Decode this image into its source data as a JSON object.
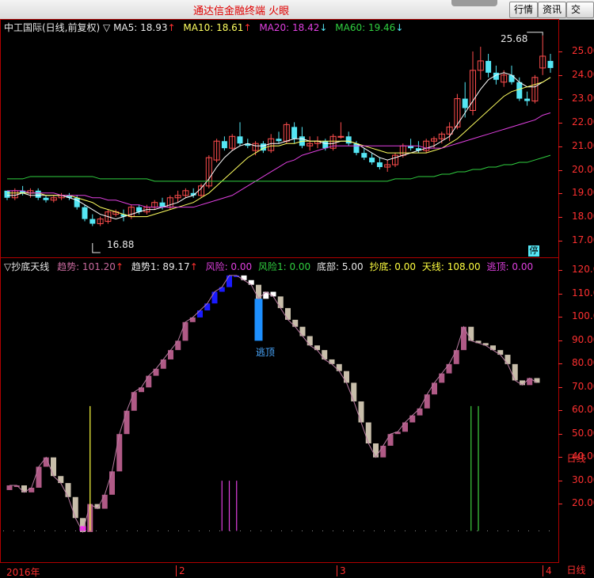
{
  "app": {
    "title": "通达信金融终端  火眼"
  },
  "toolbar": {
    "btn_hangqing": "行情",
    "btn_zixun": "资讯",
    "btn_jiaoyi": "交易"
  },
  "main_chart": {
    "stock_label": "中工国际(日线,前复权)",
    "ma5": "MA5: 18.93",
    "ma10": "MA10: 18.61",
    "ma20": "MA20: 18.42",
    "ma60": "MA60: 19.46",
    "high_label": "25.68",
    "low_label": "16.88",
    "halt_badge": "停",
    "price_ticks": [
      "25.00",
      "24.00",
      "23.00",
      "22.00",
      "21.00",
      "20.00",
      "19.00",
      "18.00",
      "17.00"
    ],
    "colors": {
      "up": "#ff4d4d",
      "down": "#55e6f4",
      "ma5": "#ffffff",
      "ma10": "#ffff60",
      "ma20": "#e040e0",
      "ma60": "#30d040"
    }
  },
  "indicator": {
    "name": "抄底天线",
    "qushi": "趋势: 101.20",
    "qushi1": "趋势1: 89.17",
    "fengxian": "风险: 0.00",
    "fengxian1": "风险1: 0.00",
    "dibu": "底部: 5.00",
    "chaodi": "抄底: 0.00",
    "tianxian": "天线: 108.00",
    "taoding": "逃顶: 0.00",
    "escape_label": "逃顶",
    "ticks": [
      "120.00",
      "110.00",
      "100.00",
      "90.00",
      "80.00",
      "70.00",
      "60.00",
      "50.00",
      "40.00",
      "30.00",
      "20.00"
    ],
    "colors": {
      "up": "#b05a86",
      "down": "#c8beaa",
      "risk": "#1a1aff",
      "escape": "#1e90ff"
    }
  },
  "dates": {
    "year": "2016年",
    "m2": "2",
    "m3": "3",
    "m4": "4"
  },
  "side": {
    "rixian1": "日线",
    "rixian2": "日线"
  },
  "chart_data": [
    {
      "type": "candlestick",
      "title": "中工国际(日线,前复权)",
      "ylim": [
        16.5,
        25.8
      ],
      "annotations": {
        "high": 25.68,
        "low": 16.88
      },
      "series": [
        {
          "name": "K",
          "ohlc": [
            [
              19.1,
              19.0,
              18.7,
              18.8
            ],
            [
              18.8,
              19.2,
              18.7,
              19.1
            ],
            [
              19.1,
              19.3,
              18.9,
              19.0
            ],
            [
              19.0,
              19.2,
              18.8,
              19.1
            ],
            [
              19.1,
              19.2,
              18.7,
              18.8
            ],
            [
              18.8,
              18.9,
              18.6,
              18.7
            ],
            [
              18.7,
              18.9,
              18.6,
              18.8
            ],
            [
              18.8,
              19.0,
              18.7,
              18.9
            ],
            [
              18.9,
              19.0,
              18.7,
              18.8
            ],
            [
              18.8,
              18.9,
              18.3,
              18.4
            ],
            [
              18.4,
              18.5,
              17.8,
              17.9
            ],
            [
              17.9,
              18.1,
              17.6,
              17.7
            ],
            [
              17.7,
              18.0,
              17.6,
              17.9
            ],
            [
              17.8,
              18.3,
              17.7,
              18.2
            ],
            [
              18.1,
              18.3,
              18.0,
              18.2
            ],
            [
              18.1,
              18.3,
              17.8,
              18.0
            ],
            [
              18.0,
              18.5,
              17.9,
              18.4
            ],
            [
              18.4,
              18.5,
              18.1,
              18.2
            ],
            [
              18.2,
              18.5,
              18.1,
              18.4
            ],
            [
              18.4,
              18.7,
              18.3,
              18.6
            ],
            [
              18.6,
              18.8,
              18.3,
              18.4
            ],
            [
              18.4,
              18.9,
              18.3,
              18.8
            ],
            [
              18.8,
              19.1,
              18.6,
              18.9
            ],
            [
              18.9,
              19.2,
              18.8,
              19.1
            ],
            [
              19.0,
              19.2,
              18.8,
              18.9
            ],
            [
              18.9,
              19.4,
              18.8,
              19.3
            ],
            [
              19.3,
              20.6,
              19.2,
              20.5
            ],
            [
              20.4,
              21.3,
              20.3,
              21.2
            ],
            [
              21.2,
              21.4,
              20.8,
              20.9
            ],
            [
              20.9,
              21.5,
              20.8,
              21.4
            ],
            [
              21.4,
              22.0,
              21.0,
              21.1
            ],
            [
              21.1,
              21.3,
              20.9,
              21.0
            ],
            [
              20.8,
              21.2,
              20.6,
              21.1
            ],
            [
              21.1,
              21.2,
              20.7,
              20.8
            ],
            [
              20.8,
              21.5,
              20.7,
              21.3
            ],
            [
              21.3,
              21.6,
              21.1,
              21.2
            ],
            [
              21.2,
              22.0,
              21.1,
              21.9
            ],
            [
              21.8,
              22.0,
              21.1,
              21.3
            ],
            [
              21.4,
              21.8,
              20.9,
              21.0
            ],
            [
              21.0,
              21.4,
              20.8,
              21.1
            ],
            [
              21.1,
              21.4,
              20.9,
              21.2
            ],
            [
              21.2,
              21.3,
              20.8,
              20.9
            ],
            [
              20.9,
              21.5,
              20.8,
              21.4
            ],
            [
              21.4,
              22.0,
              21.3,
              21.4
            ],
            [
              21.4,
              21.6,
              21.0,
              21.1
            ],
            [
              21.1,
              21.2,
              20.6,
              20.7
            ],
            [
              20.7,
              20.9,
              20.4,
              20.5
            ],
            [
              20.5,
              20.7,
              20.2,
              20.3
            ],
            [
              20.3,
              20.5,
              20.0,
              20.1
            ],
            [
              20.1,
              20.4,
              19.9,
              20.2
            ],
            [
              20.2,
              20.7,
              20.1,
              20.6
            ],
            [
              20.6,
              21.1,
              20.5,
              21.0
            ],
            [
              21.0,
              21.3,
              20.8,
              20.9
            ],
            [
              20.9,
              21.2,
              20.7,
              20.8
            ],
            [
              20.8,
              21.3,
              20.7,
              21.2
            ],
            [
              21.2,
              21.4,
              20.9,
              21.3
            ],
            [
              21.3,
              21.6,
              21.1,
              21.5
            ],
            [
              21.5,
              22.0,
              21.2,
              21.8
            ],
            [
              21.8,
              23.2,
              21.7,
              23.0
            ],
            [
              23.0,
              23.7,
              22.2,
              22.6
            ],
            [
              22.5,
              25.0,
              22.3,
              24.2
            ],
            [
              24.2,
              25.2,
              23.8,
              24.6
            ],
            [
              24.6,
              24.9,
              23.9,
              24.1
            ],
            [
              24.1,
              24.4,
              23.6,
              23.8
            ],
            [
              23.7,
              24.2,
              23.5,
              24.0
            ],
            [
              24.0,
              24.4,
              23.6,
              23.7
            ],
            [
              23.7,
              23.9,
              22.9,
              23.0
            ],
            [
              23.0,
              23.3,
              22.7,
              22.9
            ],
            [
              22.9,
              24.0,
              22.8,
              23.9
            ],
            [
              24.3,
              25.68,
              24.0,
              24.8
            ],
            [
              24.6,
              24.9,
              24.1,
              24.3
            ]
          ]
        },
        {
          "name": "MA5",
          "values": [
            18.9,
            18.9,
            19.0,
            18.9,
            18.9,
            18.9,
            18.9,
            18.9,
            18.8,
            18.7,
            18.5,
            18.3,
            18.1,
            18.0,
            17.9,
            18.0,
            18.1,
            18.2,
            18.3,
            18.3,
            18.4,
            18.5,
            18.6,
            18.8,
            18.9,
            19.2,
            19.6,
            20.1,
            20.5,
            20.8,
            21.0,
            21.1,
            21.0,
            21.0,
            21.1,
            21.1,
            21.2,
            21.3,
            21.3,
            21.2,
            21.2,
            21.1,
            21.1,
            21.2,
            21.2,
            21.1,
            20.9,
            20.7,
            20.5,
            20.4,
            20.5,
            20.6,
            20.7,
            20.8,
            20.9,
            21.0,
            21.2,
            21.4,
            21.9,
            22.4,
            22.9,
            23.4,
            23.8,
            24.0,
            24.1,
            24.0,
            23.7,
            23.5,
            23.5,
            23.7,
            23.9
          ]
        },
        {
          "name": "MA10",
          "values": [
            19.0,
            19.0,
            19.0,
            19.0,
            19.0,
            18.9,
            18.9,
            18.9,
            18.9,
            18.8,
            18.7,
            18.6,
            18.4,
            18.3,
            18.2,
            18.1,
            18.0,
            18.0,
            18.0,
            18.1,
            18.2,
            18.3,
            18.4,
            18.5,
            18.6,
            18.8,
            19.0,
            19.3,
            19.6,
            19.9,
            20.2,
            20.5,
            20.7,
            20.9,
            21.0,
            21.0,
            21.1,
            21.1,
            21.2,
            21.2,
            21.2,
            21.2,
            21.2,
            21.2,
            21.2,
            21.1,
            21.0,
            20.9,
            20.8,
            20.7,
            20.7,
            20.7,
            20.7,
            20.7,
            20.7,
            20.8,
            20.9,
            21.1,
            21.3,
            21.6,
            21.9,
            22.2,
            22.5,
            22.8,
            23.1,
            23.3,
            23.4,
            23.5,
            23.6,
            23.7,
            23.9
          ]
        },
        {
          "name": "MA20",
          "values": [
            19.1,
            19.1,
            19.1,
            19.0,
            19.0,
            19.0,
            19.0,
            18.9,
            18.9,
            18.9,
            18.9,
            18.8,
            18.8,
            18.7,
            18.7,
            18.6,
            18.5,
            18.5,
            18.4,
            18.4,
            18.4,
            18.4,
            18.4,
            18.4,
            18.4,
            18.5,
            18.6,
            18.7,
            18.8,
            18.9,
            19.1,
            19.3,
            19.5,
            19.7,
            19.9,
            20.1,
            20.3,
            20.4,
            20.6,
            20.7,
            20.8,
            20.9,
            21.0,
            21.0,
            21.0,
            21.0,
            21.0,
            21.0,
            21.0,
            21.0,
            21.0,
            21.0,
            21.0,
            21.0,
            20.9,
            20.9,
            20.9,
            21.0,
            21.1,
            21.2,
            21.3,
            21.4,
            21.5,
            21.6,
            21.7,
            21.8,
            21.9,
            22.0,
            22.1,
            22.3,
            22.4
          ]
        },
        {
          "name": "MA60",
          "values": [
            19.6,
            19.6,
            19.6,
            19.7,
            19.7,
            19.7,
            19.7,
            19.7,
            19.7,
            19.7,
            19.7,
            19.7,
            19.6,
            19.6,
            19.6,
            19.6,
            19.6,
            19.6,
            19.6,
            19.5,
            19.5,
            19.5,
            19.5,
            19.5,
            19.5,
            19.5,
            19.5,
            19.5,
            19.5,
            19.5,
            19.5,
            19.5,
            19.5,
            19.5,
            19.5,
            19.5,
            19.5,
            19.5,
            19.5,
            19.5,
            19.5,
            19.5,
            19.5,
            19.5,
            19.5,
            19.5,
            19.5,
            19.5,
            19.5,
            19.5,
            19.6,
            19.6,
            19.6,
            19.7,
            19.7,
            19.7,
            19.8,
            19.8,
            19.9,
            19.9,
            20.0,
            20.0,
            20.1,
            20.1,
            20.2,
            20.2,
            20.3,
            20.3,
            20.4,
            20.5,
            20.6
          ]
        }
      ]
    },
    {
      "type": "bar",
      "title": "抄底天线",
      "ylim": [
        8,
        123
      ],
      "series": [
        {
          "name": "趋势",
          "values": [
            28,
            28,
            25,
            27,
            36,
            40,
            32,
            29,
            23,
            14,
            8,
            20,
            18,
            24,
            34,
            50,
            60,
            68,
            70,
            75,
            78,
            82,
            86,
            90,
            98,
            100,
            103,
            106,
            111,
            113,
            118,
            118,
            116,
            114,
            108,
            111,
            109,
            104,
            99,
            96,
            92,
            88,
            86,
            82,
            80,
            77,
            72,
            64,
            55,
            46,
            40,
            45,
            50,
            51,
            55,
            58,
            61,
            67,
            72,
            76,
            80,
            86,
            96,
            90,
            89,
            88,
            86,
            84,
            80,
            73,
            71,
            74,
            72
          ]
        },
        {
          "name": "风险",
          "values": [
            0,
            0,
            0,
            0,
            0,
            0,
            0,
            0,
            0,
            0,
            0,
            0,
            0,
            0,
            0,
            0,
            0,
            0,
            0,
            0,
            0,
            0,
            0,
            0,
            0,
            0,
            110,
            110,
            110,
            110,
            110,
            110,
            0,
            0,
            0,
            0,
            0,
            0,
            0,
            0,
            0,
            0,
            0,
            0,
            0,
            0,
            0,
            0,
            0,
            0,
            0,
            0,
            0,
            0,
            0,
            0,
            0,
            0,
            0,
            0,
            0,
            0,
            0,
            0,
            0,
            0,
            0,
            0,
            0,
            0,
            0,
            0,
            0
          ]
        }
      ]
    }
  ]
}
